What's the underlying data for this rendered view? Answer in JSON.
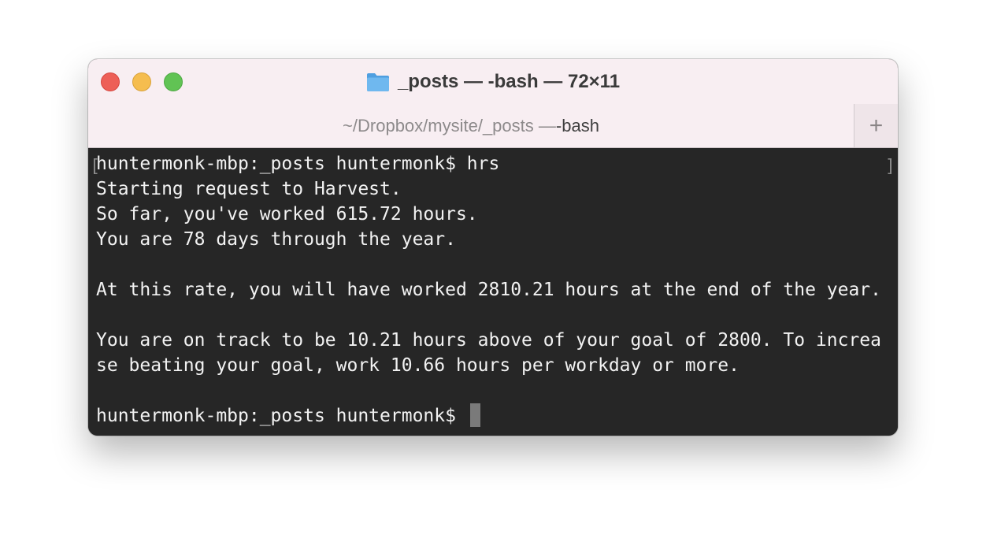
{
  "window": {
    "title": "_posts — -bash — 72×11",
    "title_icon": "folder-icon"
  },
  "tab": {
    "path": "~/Dropbox/mysite/_posts — ",
    "command": "-bash",
    "new_tab_label": "+"
  },
  "terminal": {
    "lines": [
      "huntermonk-mbp:_posts huntermonk$ hrs",
      "Starting request to Harvest.",
      "So far, you've worked 615.72 hours.",
      "You are 78 days through the year.",
      "",
      "At this rate, you will have worked 2810.21 hours at the end of the year.",
      "",
      "You are on track to be 10.21 hours above of your goal of 2800. To increa",
      "se beating your goal, work 10.66 hours per workday or more.",
      "",
      "huntermonk-mbp:_posts huntermonk$ "
    ],
    "mark_left": "[",
    "mark_right": "]"
  },
  "colors": {
    "titlebar_bg": "#f8eef2",
    "terminal_bg": "#262626",
    "terminal_fg": "#f2f2f2",
    "close": "#ed5f57",
    "minimize": "#f5bd4f",
    "zoom": "#61c354",
    "folder": "#5aa9e6"
  }
}
